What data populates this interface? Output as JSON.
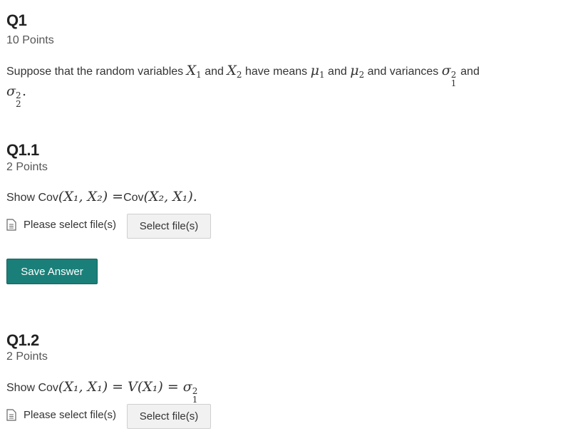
{
  "q1": {
    "title": "Q1",
    "points": "10 Points",
    "text_pre": "Suppose that the random variables ",
    "and1": " and ",
    "have_means": " have means ",
    "and2": " and ",
    "and_variances": " and variances ",
    "and3": " and",
    "x1": "X",
    "x2": "X",
    "mu1": "μ",
    "mu2": "μ",
    "sigma1": "σ",
    "sigma2": "σ",
    "sub1": "1",
    "sub2": "2",
    "sup2": "2",
    "period": "."
  },
  "q1_1": {
    "title": "Q1.1",
    "points": "2 Points",
    "show": "Show ",
    "cov": "Cov",
    "expr_a": "(X₁, X₂)",
    "equals": " =",
    "expr_b": "(X₂, X₁).",
    "file_label": "Please select file(s)",
    "select_button": "Select file(s)",
    "save_button": "Save Answer"
  },
  "q1_2": {
    "title": "Q1.2",
    "points": "2 Points",
    "show": "Show ",
    "cov": "Cov",
    "expr": "(X₁, X₁) = V(X₁) = σ",
    "file_label": "Please select file(s)",
    "select_button": "Select file(s)"
  },
  "colors": {
    "save_button_bg": "#1b7f79",
    "text": "#333333",
    "button_bg": "#f1f1f1"
  }
}
